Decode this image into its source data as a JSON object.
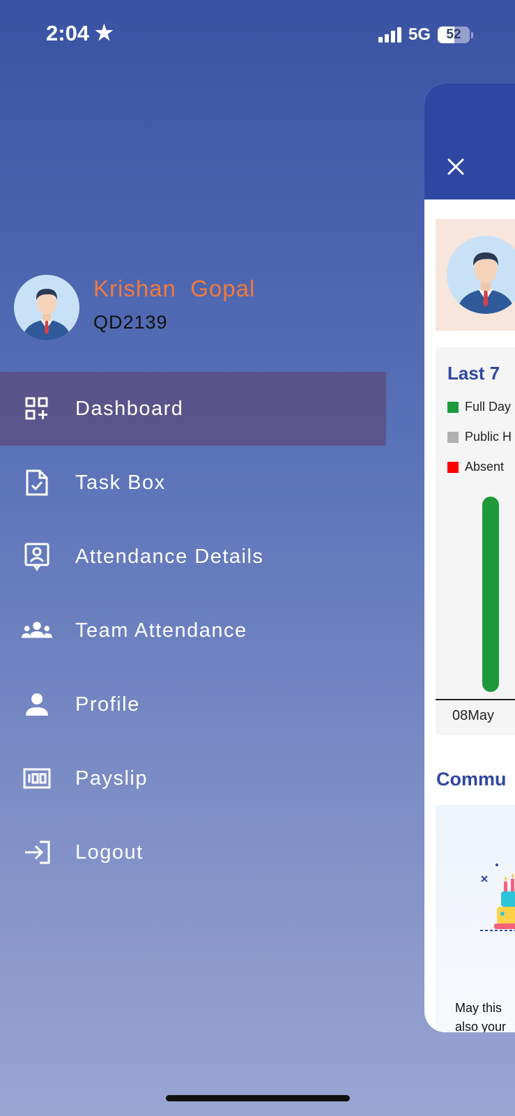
{
  "status_bar": {
    "time": "2:04",
    "network": "5G",
    "battery": "52",
    "battery_level": 0.52
  },
  "profile": {
    "name": "Krishan  Gopal",
    "code": "QD2139",
    "name_color": "#f27a3c"
  },
  "menu": {
    "items": [
      {
        "label": "Dashboard",
        "icon": "dashboard-icon",
        "active": true
      },
      {
        "label": "Task Box",
        "icon": "task-file-icon",
        "active": false
      },
      {
        "label": "Attendance Details",
        "icon": "attendance-badge-icon",
        "active": false
      },
      {
        "label": "Team Attendance",
        "icon": "team-icon",
        "active": false
      },
      {
        "label": "Profile",
        "icon": "person-icon",
        "active": false
      },
      {
        "label": "Payslip",
        "icon": "payslip-icon",
        "active": false
      },
      {
        "label": "Logout",
        "icon": "logout-icon",
        "active": false
      }
    ]
  },
  "background_page": {
    "chart_title": "Last 7",
    "legend": [
      {
        "label": "Full Day",
        "color": "#1e9a3a"
      },
      {
        "label": "Public H",
        "color": "#b0b0b0"
      },
      {
        "label": "Absent",
        "color": "#ff0000"
      }
    ],
    "section_title": "Commu",
    "community_text_1": "May this",
    "community_text_2": "also your"
  },
  "chart_data": {
    "type": "bar",
    "title": "Last 7",
    "categories": [
      "08May"
    ],
    "series": [
      {
        "name": "Full Day",
        "values": [
          1
        ]
      }
    ],
    "ylim": [
      0,
      1
    ],
    "legend_position": "top-left"
  },
  "colors": {
    "accent": "#2f47a0",
    "active_menu_bg": "#5a5082",
    "full_day": "#1e9a3a"
  }
}
